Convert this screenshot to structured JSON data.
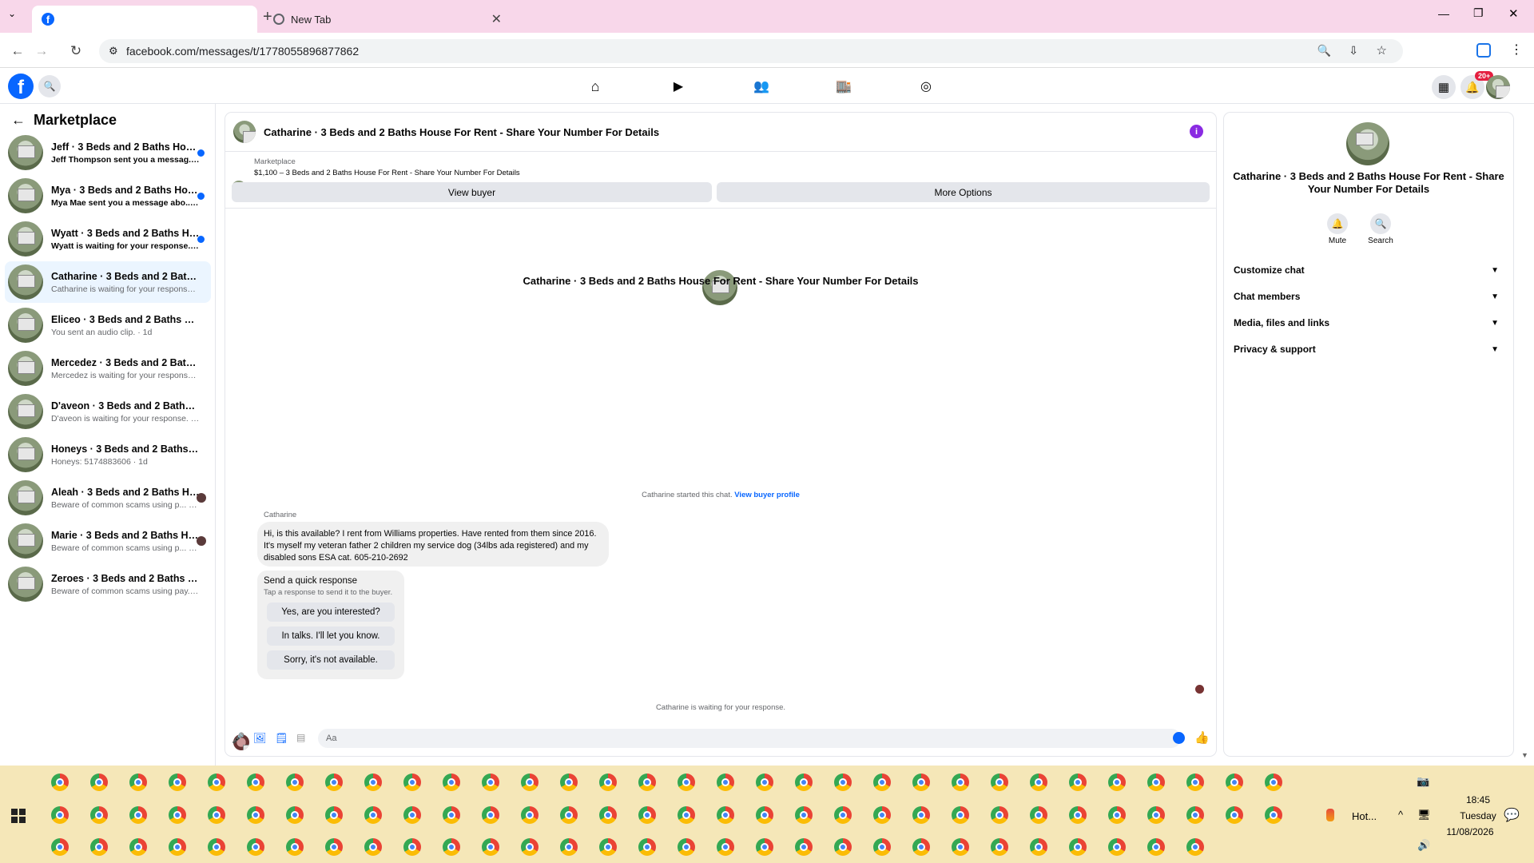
{
  "browser": {
    "tabs": [
      {
        "label": ""
      },
      {
        "label": "New Tab"
      }
    ],
    "url": "facebook.com/messages/t/1778055896877862"
  },
  "header": {
    "notification_badge": "20+"
  },
  "sidebar": {
    "title": "Marketplace",
    "conversations": [
      {
        "title": "Jeff · 3 Beds and 2 Baths House ...",
        "sub": "Jeff Thompson sent you a messag... · 1h",
        "unread": true
      },
      {
        "title": "Mya · 3 Beds and 2 Baths House ...",
        "sub": "Mya Mae sent you a message abo... · 2h",
        "unread": true
      },
      {
        "title": "Wyatt · 3 Beds and 2 Baths Hous...",
        "sub": "Wyatt is waiting for your response. · 5h",
        "unread": true
      },
      {
        "title": "Catharine · 3 Beds and 2 Baths Ho...",
        "sub": "Catharine is waiting for your response. · 5h",
        "unread": false
      },
      {
        "title": "Eliceo · 3 Beds and 2 Baths House ...",
        "sub": "You sent an audio clip. · 1d",
        "unread": false
      },
      {
        "title": "Mercedez · 3 Beds and 2 Baths Ho...",
        "sub": "Mercedez is waiting for your response. · 1d",
        "unread": false
      },
      {
        "title": "D'aveon · 3 Beds and 2 Baths Hous...",
        "sub": "D'aveon is waiting for your response. · 1d",
        "unread": false
      },
      {
        "title": "Honeys · 3 Beds and 2 Baths Hous...",
        "sub": "Honeys: 5174883606 · 1d",
        "unread": false
      },
      {
        "title": "Aleah · 3 Beds and 2 Baths Hous...",
        "sub": "Beware of common scams using p... · 2d",
        "unread": false
      },
      {
        "title": "Marie · 3 Beds and 2 Baths Hous...",
        "sub": "Beware of common scams using p... · 2d",
        "unread": false
      },
      {
        "title": "Zeroes · 3 Beds and 2 Baths House...",
        "sub": "Beware of common scams using pay... · 2d",
        "unread": false
      }
    ]
  },
  "chat": {
    "header_title": "Catharine · 3 Beds and 2 Baths House For Rent - Share Your Number For Details",
    "listing_label": "Marketplace",
    "listing_price": "$1,100 – 3 Beds and 2 Baths House For Rent - Share Your Number For Details",
    "view_buyer": "View buyer",
    "more_options": "More Options",
    "center_title": "Catharine · 3 Beds and 2 Baths House For Rent - Share Your Number For Details",
    "started_text": "Catharine started this chat.",
    "view_profile": "View buyer profile",
    "sender": "Catharine",
    "message": "Hi, is this available? I rent from Williams properties. Have rented from them since 2016. It's myself my veteran father 2 children my service dog (34lbs ada registered) and my disabled sons ESA cat. 605-210-2692",
    "quick_title": "Send a quick response",
    "quick_sub": "Tap a response to send it to the buyer.",
    "quick_options": [
      "Yes, are you interested?",
      "In talks. I'll let you know.",
      "Sorry, it's not available."
    ],
    "waiting_text": "Catharine is waiting for your response.",
    "input_placeholder": "Aa"
  },
  "right_panel": {
    "title": "Catharine · 3 Beds and 2 Baths House For Rent - Share Your Number For Details",
    "mute": "Mute",
    "search": "Search",
    "sections": [
      "Customize chat",
      "Chat members",
      "Media, files and links",
      "Privacy & support"
    ]
  },
  "taskbar": {
    "weather": "Hot...",
    "time": "18:45",
    "day": "Tuesday",
    "date": "11/08/2026"
  },
  "colors": {
    "accent": "#0866ff",
    "tabbar": "#f8d7ea",
    "taskbar": "#f5e7b8",
    "selected": "#ebf5ff"
  }
}
